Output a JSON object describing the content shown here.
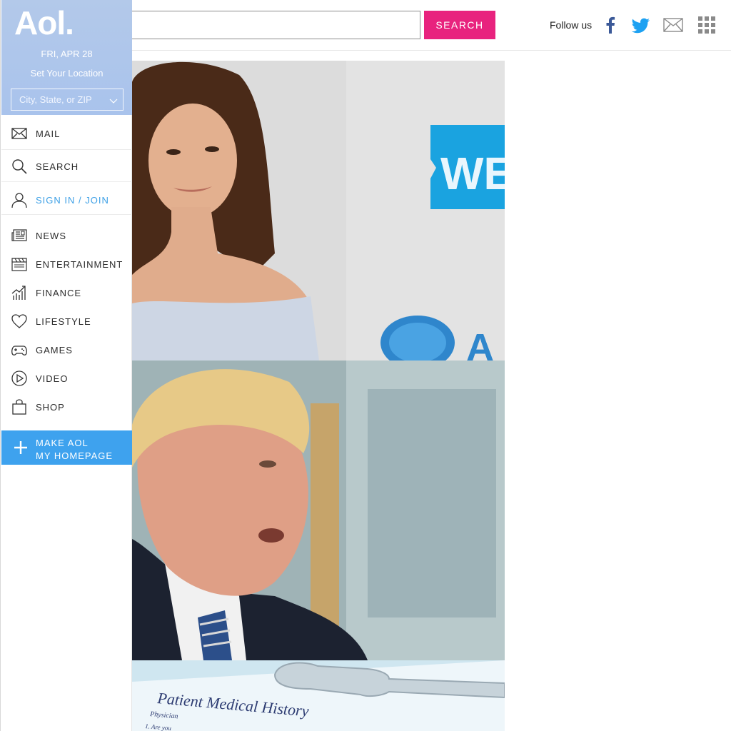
{
  "brand": {
    "logo_text": "Aol.",
    "accent": "#3ea2ee",
    "search_color": "#e8237e",
    "panel_color": "#afc6eb"
  },
  "sidebar": {
    "date": "FRI, APR 28",
    "set_location": "Set Your Location",
    "location_placeholder": "City, State, or ZIP",
    "top_items": [
      {
        "label": "MAIL",
        "icon": "mail-icon"
      },
      {
        "label": "SEARCH",
        "icon": "search-icon"
      },
      {
        "label": "SIGN IN / JOIN",
        "icon": "user-icon"
      }
    ],
    "items": [
      {
        "label": "NEWS",
        "icon": "newspaper-icon"
      },
      {
        "label": "ENTERTAINMENT",
        "icon": "clapperboard-icon"
      },
      {
        "label": "FINANCE",
        "icon": "chart-icon"
      },
      {
        "label": "LIFESTYLE",
        "icon": "heart-icon"
      },
      {
        "label": "GAMES",
        "icon": "gamepad-icon"
      },
      {
        "label": "VIDEO",
        "icon": "play-icon"
      },
      {
        "label": "SHOP",
        "icon": "shopping-bag-icon"
      }
    ],
    "make_homepage": {
      "line1": "MAKE AOL",
      "line2": "MY HOMEPAGE"
    }
  },
  "header": {
    "search_value": "",
    "search_button": "SEARCH",
    "follow_label": "Follow us",
    "social": [
      "facebook-icon",
      "twitter-icon",
      "envelope-icon",
      "grid-menu-icon"
    ]
  },
  "main": {
    "cards": [
      {
        "image": "woman-portrait-photo",
        "sign_text": "WE"
      },
      {
        "image": "man-speaking-photo"
      },
      {
        "image": "medical-form-photo",
        "form_title": "Patient Medical History",
        "form_line1": "Physician",
        "form_line2": "1. Are you"
      }
    ]
  }
}
